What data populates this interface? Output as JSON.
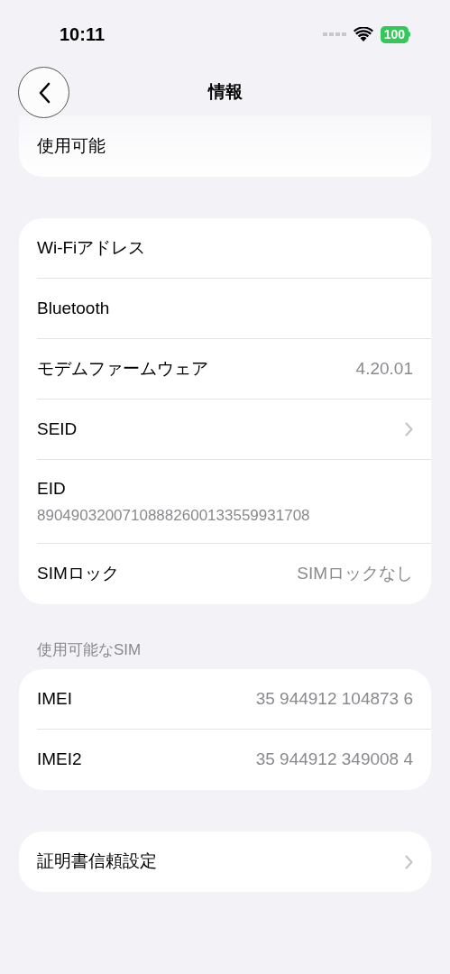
{
  "status_bar": {
    "time": "10:11",
    "battery": "100"
  },
  "nav": {
    "title": "情報"
  },
  "sections": [
    {
      "rows": [
        {
          "kind": "plain",
          "label": "使用可能"
        }
      ],
      "partial": true
    },
    {
      "rows": [
        {
          "kind": "plain",
          "label": "Wi-Fiアドレス"
        },
        {
          "kind": "plain",
          "label": "Bluetooth"
        },
        {
          "kind": "value",
          "label": "モデムファームウェア",
          "value": "4.20.01"
        },
        {
          "kind": "chevron",
          "label": "SEID"
        },
        {
          "kind": "subtitle",
          "label": "EID",
          "value": "89049032007108882600133559931708"
        },
        {
          "kind": "value",
          "label": "SIMロック",
          "value": "SIMロックなし"
        }
      ]
    },
    {
      "header": "使用可能なSIM",
      "rows": [
        {
          "kind": "value",
          "label": "IMEI",
          "value": "35 944912 104873 6"
        },
        {
          "kind": "value",
          "label": "IMEI2",
          "value": "35 944912 349008 4"
        }
      ]
    },
    {
      "rows": [
        {
          "kind": "chevron",
          "label": "証明書信頼設定"
        }
      ]
    }
  ]
}
